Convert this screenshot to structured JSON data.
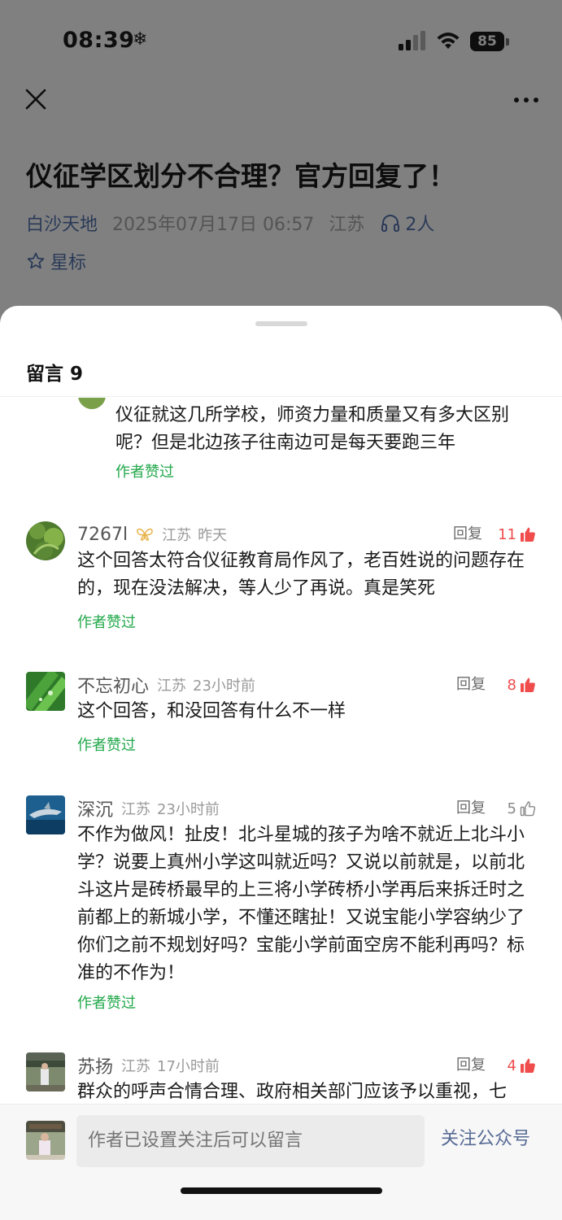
{
  "status_bar": {
    "time": "08:39",
    "snow_glyph": "❄",
    "battery_level": "85"
  },
  "article": {
    "title": "仪征学区划分不合理？官方回复了！",
    "author": "白沙天地",
    "date": "2025年07月17日 06:57",
    "region": "江苏",
    "listeners": "2人",
    "star_label": "星标"
  },
  "sheet": {
    "title": "留言 9"
  },
  "partial_comment": {
    "text": "仪征就这几所学校，师资力量和质量又有多大区别呢？但是北边孩子往南边可是每天要跑三年",
    "tag": "作者赞过"
  },
  "comments": [
    {
      "name": "7267l",
      "region": "江苏",
      "time": "昨天",
      "reply_label": "回复",
      "likes": "11",
      "liked": true,
      "text": "这个回答太符合仪征教育局作风了，老百姓说的问题存在的，现在没法解决，等人少了再说。真是笑死",
      "tag": "作者赞过"
    },
    {
      "name": "不忘初心",
      "region": "江苏",
      "time": "23小时前",
      "reply_label": "回复",
      "likes": "8",
      "liked": true,
      "text": "这个回答，和没回答有什么不一样",
      "tag": "作者赞过"
    },
    {
      "name": "深沉",
      "region": "江苏",
      "time": "23小时前",
      "reply_label": "回复",
      "likes": "5",
      "liked": false,
      "text": "不作为做风！扯皮！北斗星城的孩子为啥不就近上北斗小学？说要上真州小学这叫就近吗？又说以前就是，以前北斗这片是砖桥最早的上三将小学砖桥小学再后来拆迁时之前都上的新城小学，不懂还瞎扯！又说宝能小学容纳少了你们之前不规划好吗？宝能小学前面空房不能利再吗？标准的不作为！",
      "tag": "作者赞过"
    },
    {
      "name": "苏扬",
      "region": "江苏",
      "time": "17小时前",
      "reply_label": "回复",
      "likes": "4",
      "liked": true,
      "text": "群众的呼声合情合理、政府相关部门应该予以重视，七"
    }
  ],
  "bottom_bar": {
    "input_placeholder": "作者已设置关注后可以留言",
    "follow_label": "关注公众号"
  },
  "colors": {
    "dim_background": "#808080",
    "accent_link": "#576b95",
    "like_red": "#f04c4c",
    "author_liked_green": "#21a84a"
  }
}
